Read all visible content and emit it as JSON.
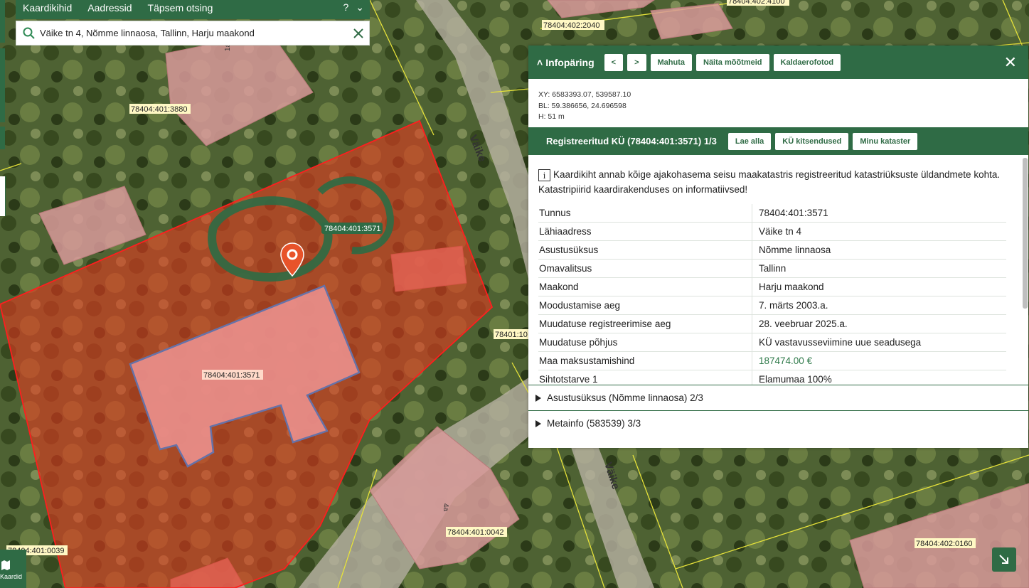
{
  "nav": {
    "tabs": [
      "Kaardikihid",
      "Aadressid",
      "Täpsem otsing"
    ],
    "help_label": "?"
  },
  "search": {
    "value": "Väike tn 4, Nõmme linnaosa, Tallinn, Harju maakond"
  },
  "map": {
    "street_label": "Väike",
    "house_numbers": [
      "1a",
      "4a"
    ],
    "parcel_labels": [
      "78404:401:3880",
      "78404:402:2040",
      "78404:402:4100",
      "78404:401:3571",
      "78404:401:3571",
      "78401:10",
      "78404:401:0042",
      "78404:401:0039",
      "78404:402:0160"
    ],
    "bottom_left_label": "Kaardid",
    "colors": {
      "selected_parcel": "#e8381f",
      "highlight_ring": "#2e6b45",
      "marker": "#e8532a"
    }
  },
  "panel": {
    "title": "Infopäring",
    "nav_prev": "<",
    "nav_next": ">",
    "buttons": [
      "Mahuta",
      "Näita mõõtmeid",
      "Kaldaerofotod"
    ],
    "coordinates": [
      "XY: 6583393.07, 539587.10",
      "BL: 59.386656, 24.696598",
      "H: 51 m"
    ],
    "section": {
      "title": "Registreeritud KÜ (78404:401:3571) 1/3",
      "buttons": [
        "Lae alla",
        "KÜ kitsendused",
        "Minu kataster"
      ]
    },
    "info_text": "Kaardikiht annab kõige ajakohasema seisu maakatastris registreeritud katastriüksuste üldandmete kohta. Katastripiirid kaardirakenduses on informatiivsed!",
    "rows": [
      {
        "label": "Tunnus",
        "value": "78404:401:3571"
      },
      {
        "label": "Lähiaadress",
        "value": "Väike tn 4"
      },
      {
        "label": "Asustusüksus",
        "value": "Nõmme linnaosa"
      },
      {
        "label": "Omavalitsus",
        "value": "Tallinn"
      },
      {
        "label": "Maakond",
        "value": "Harju maakond"
      },
      {
        "label": "Moodustamise aeg",
        "value": "7. märts 2003.a."
      },
      {
        "label": "Muudatuse registreerimise aeg",
        "value": "28. veebruar 2025.a."
      },
      {
        "label": "Muudatuse põhjus",
        "value": "KÜ vastavusseviimine uue seadusega"
      },
      {
        "label": "Maa maksustamishind",
        "value": "187474.00 €"
      },
      {
        "label": "Sihtotstarve 1",
        "value": "Elamumaa 100%"
      }
    ],
    "accordions": [
      "Asustusüksus (Nõmme linnaosa) 2/3",
      "Metainfo (583539) 3/3"
    ]
  }
}
